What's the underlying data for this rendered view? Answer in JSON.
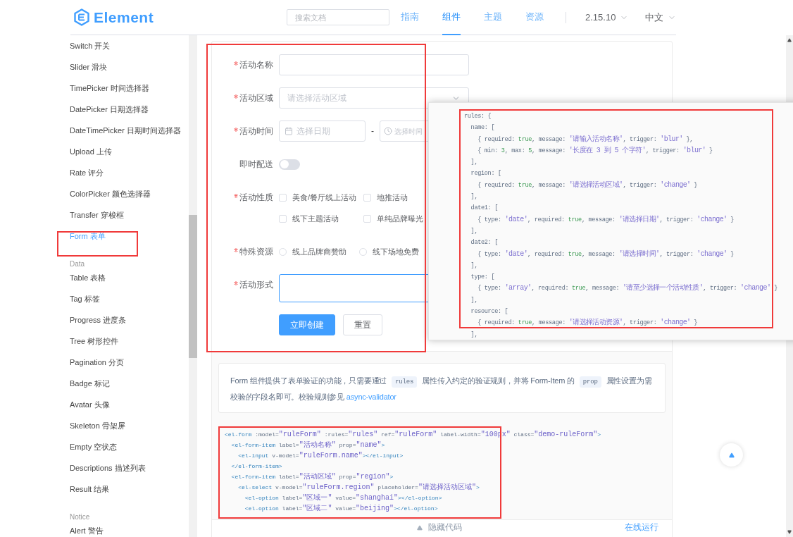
{
  "header": {
    "logo": "Element",
    "search": {
      "placeholder": "搜索文档"
    },
    "nav": [
      {
        "label": "指南",
        "selected": false
      },
      {
        "label": "组件",
        "selected": true
      },
      {
        "label": "主题",
        "selected": false
      },
      {
        "label": "资源",
        "selected": false
      }
    ],
    "version": "2.15.10",
    "language": "中文"
  },
  "sidebar": {
    "items": [
      {
        "kind": "item",
        "label": "Switch 开关",
        "selected": false
      },
      {
        "kind": "item",
        "label": "Slider 滑块",
        "selected": false
      },
      {
        "kind": "item",
        "label": "TimePicker 时间选择器",
        "selected": false
      },
      {
        "kind": "item",
        "label": "DatePicker 日期选择器",
        "selected": false
      },
      {
        "kind": "item",
        "label": "DateTimePicker 日期时间选择器",
        "selected": false
      },
      {
        "kind": "item",
        "label": "Upload 上传",
        "selected": false
      },
      {
        "kind": "item",
        "label": "Rate 评分",
        "selected": false
      },
      {
        "kind": "item",
        "label": "ColorPicker 颜色选择器",
        "selected": false
      },
      {
        "kind": "item",
        "label": "Transfer 穿梭框",
        "selected": false
      },
      {
        "kind": "item",
        "label": "Form 表单",
        "selected": true
      },
      {
        "kind": "group",
        "label": "Data"
      },
      {
        "kind": "item",
        "label": "Table 表格",
        "selected": false
      },
      {
        "kind": "item",
        "label": "Tag 标签",
        "selected": false
      },
      {
        "kind": "item",
        "label": "Progress 进度条",
        "selected": false
      },
      {
        "kind": "item",
        "label": "Tree 树形控件",
        "selected": false
      },
      {
        "kind": "item",
        "label": "Pagination 分页",
        "selected": false
      },
      {
        "kind": "item",
        "label": "Badge 标记",
        "selected": false
      },
      {
        "kind": "item",
        "label": "Avatar 头像",
        "selected": false
      },
      {
        "kind": "item",
        "label": "Skeleton 骨架屏",
        "selected": false
      },
      {
        "kind": "item",
        "label": "Empty 空状态",
        "selected": false
      },
      {
        "kind": "item",
        "label": "Descriptions 描述列表",
        "selected": false
      },
      {
        "kind": "item",
        "label": "Result 结果",
        "selected": false
      },
      {
        "kind": "group",
        "label": "Notice"
      },
      {
        "kind": "item",
        "label": "Alert 警告",
        "selected": false
      }
    ]
  },
  "form": {
    "fields": [
      {
        "kind": "input",
        "label": "活动名称",
        "required": true
      },
      {
        "kind": "select",
        "label": "活动区域",
        "required": true,
        "placeholder": "请选择活动区域"
      },
      {
        "kind": "datetime",
        "label": "活动时间",
        "required": true,
        "date_placeholder": "选择日期",
        "separator": "-",
        "time_placeholder": "选择时间"
      },
      {
        "kind": "switch",
        "label": "即时配送",
        "required": false,
        "on": false
      },
      {
        "kind": "checkboxes",
        "label": "活动性质",
        "required": true,
        "options": [
          {
            "label": "美食/餐厅线上活动",
            "checked": false
          },
          {
            "label": "地推活动",
            "checked": false
          },
          {
            "label": "线下主题活动",
            "checked": false
          },
          {
            "label": "单纯品牌曝光",
            "checked": false
          }
        ]
      },
      {
        "kind": "radios",
        "label": "特殊资源",
        "required": true,
        "options": [
          {
            "label": "线上品牌商赞助",
            "selected": false
          },
          {
            "label": "线下场地免费",
            "selected": false
          }
        ]
      },
      {
        "kind": "textarea",
        "label": "活动形式",
        "required": true,
        "focused": true
      }
    ],
    "buttons": [
      {
        "label": "立即创建",
        "kind": "primary"
      },
      {
        "label": "重置",
        "kind": "default"
      }
    ]
  },
  "description": [
    {
      "kind": "text",
      "text": "Form 组件提供了表单验证的功能，只需要通过"
    },
    {
      "kind": "code",
      "text": "rules"
    },
    {
      "kind": "text",
      "text": "属性传入约定的验证规则，并将 Form-Item 的"
    },
    {
      "kind": "code",
      "text": "prop"
    },
    {
      "kind": "text",
      "text": "属性设置为需校验的字段名即可。校验规则参见 "
    },
    {
      "kind": "link",
      "text": "async-validator"
    }
  ],
  "code": [
    [
      {
        "kind": "tag",
        "text": "<el-form"
      },
      {
        "kind": "attr",
        "text": " :model="
      },
      {
        "kind": "string",
        "text": "\"ruleForm\""
      },
      {
        "kind": "attr",
        "text": " :rules="
      },
      {
        "kind": "string",
        "text": "\"rules\""
      },
      {
        "kind": "attr",
        "text": " ref="
      },
      {
        "kind": "string",
        "text": "\"ruleForm\""
      },
      {
        "kind": "attr",
        "text": " label-width="
      },
      {
        "kind": "string",
        "text": "\"100px\""
      },
      {
        "kind": "attr",
        "text": " class="
      },
      {
        "kind": "string",
        "text": "\"demo-ruleForm\""
      },
      {
        "kind": "tag",
        "text": ">"
      }
    ],
    [
      {
        "kind": "tag",
        "text": "  <el-form-item"
      },
      {
        "kind": "attr",
        "text": " label="
      },
      {
        "kind": "string",
        "text": "\"活动名称\""
      },
      {
        "kind": "attr",
        "text": " prop="
      },
      {
        "kind": "string",
        "text": "\"name\""
      },
      {
        "kind": "tag",
        "text": ">"
      }
    ],
    [
      {
        "kind": "tag",
        "text": "    <el-input"
      },
      {
        "kind": "attr",
        "text": " v-model="
      },
      {
        "kind": "string",
        "text": "\"ruleForm.name\""
      },
      {
        "kind": "tag",
        "text": "></el-input>"
      }
    ],
    [
      {
        "kind": "tag",
        "text": "  </el-form-item>"
      }
    ],
    [
      {
        "kind": "tag",
        "text": "  <el-form-item"
      },
      {
        "kind": "attr",
        "text": " label="
      },
      {
        "kind": "string",
        "text": "\"活动区域\""
      },
      {
        "kind": "attr",
        "text": " prop="
      },
      {
        "kind": "string",
        "text": "\"region\""
      },
      {
        "kind": "tag",
        "text": ">"
      }
    ],
    [
      {
        "kind": "tag",
        "text": "    <el-select"
      },
      {
        "kind": "attr",
        "text": " v-model="
      },
      {
        "kind": "string",
        "text": "\"ruleForm.region\""
      },
      {
        "kind": "attr",
        "text": " placeholder="
      },
      {
        "kind": "string",
        "text": "\"请选择活动区域\""
      },
      {
        "kind": "tag",
        "text": ">"
      }
    ],
    [
      {
        "kind": "tag",
        "text": "      <el-option"
      },
      {
        "kind": "attr",
        "text": " label="
      },
      {
        "kind": "string",
        "text": "\"区域一\""
      },
      {
        "kind": "attr",
        "text": " value="
      },
      {
        "kind": "string",
        "text": "\"shanghai\""
      },
      {
        "kind": "tag",
        "text": "></el-option>"
      }
    ],
    [
      {
        "kind": "tag",
        "text": "      <el-option"
      },
      {
        "kind": "attr",
        "text": " label="
      },
      {
        "kind": "string",
        "text": "\"区域二\""
      },
      {
        "kind": "attr",
        "text": " value="
      },
      {
        "kind": "string",
        "text": "\"beijing\""
      },
      {
        "kind": "tag",
        "text": "></el-option>"
      }
    ]
  ],
  "code_footer": {
    "toggle": "隐藏代码",
    "run": "在线运行"
  },
  "popup": {
    "lines": [
      [
        {
          "kind": "plain",
          "text": "rules: {"
        }
      ],
      [
        {
          "kind": "plain",
          "text": "  name: ["
        }
      ],
      [
        {
          "kind": "plain",
          "text": "    { required: "
        },
        {
          "kind": "literal",
          "text": "true"
        },
        {
          "kind": "plain",
          "text": ", message: "
        },
        {
          "kind": "string",
          "text": "'请输入活动名称'"
        },
        {
          "kind": "plain",
          "text": ", trigger: "
        },
        {
          "kind": "string",
          "text": "'blur'"
        },
        {
          "kind": "plain",
          "text": " },"
        }
      ],
      [
        {
          "kind": "plain",
          "text": "    { min: "
        },
        {
          "kind": "literal",
          "text": "3"
        },
        {
          "kind": "plain",
          "text": ", max: "
        },
        {
          "kind": "literal",
          "text": "5"
        },
        {
          "kind": "plain",
          "text": ", message: "
        },
        {
          "kind": "string",
          "text": "'长度在 3 到 5 个字符'"
        },
        {
          "kind": "plain",
          "text": ", trigger: "
        },
        {
          "kind": "string",
          "text": "'blur'"
        },
        {
          "kind": "plain",
          "text": " }"
        }
      ],
      [
        {
          "kind": "plain",
          "text": "  ],"
        }
      ],
      [
        {
          "kind": "plain",
          "text": "  region: ["
        }
      ],
      [
        {
          "kind": "plain",
          "text": "    { required: "
        },
        {
          "kind": "literal",
          "text": "true"
        },
        {
          "kind": "plain",
          "text": ", message: "
        },
        {
          "kind": "string",
          "text": "'请选择活动区域'"
        },
        {
          "kind": "plain",
          "text": ", trigger: "
        },
        {
          "kind": "string",
          "text": "'change'"
        },
        {
          "kind": "plain",
          "text": " }"
        }
      ],
      [
        {
          "kind": "plain",
          "text": "  ],"
        }
      ],
      [
        {
          "kind": "plain",
          "text": "  date1: ["
        }
      ],
      [
        {
          "kind": "plain",
          "text": "    { type: "
        },
        {
          "kind": "string",
          "text": "'date'"
        },
        {
          "kind": "plain",
          "text": ", required: "
        },
        {
          "kind": "literal",
          "text": "true"
        },
        {
          "kind": "plain",
          "text": ", message: "
        },
        {
          "kind": "string",
          "text": "'请选择日期'"
        },
        {
          "kind": "plain",
          "text": ", trigger: "
        },
        {
          "kind": "string",
          "text": "'change'"
        },
        {
          "kind": "plain",
          "text": " }"
        }
      ],
      [
        {
          "kind": "plain",
          "text": "  ],"
        }
      ],
      [
        {
          "kind": "plain",
          "text": "  date2: ["
        }
      ],
      [
        {
          "kind": "plain",
          "text": "    { type: "
        },
        {
          "kind": "string",
          "text": "'date'"
        },
        {
          "kind": "plain",
          "text": ", required: "
        },
        {
          "kind": "literal",
          "text": "true"
        },
        {
          "kind": "plain",
          "text": ", message: "
        },
        {
          "kind": "string",
          "text": "'请选择时间'"
        },
        {
          "kind": "plain",
          "text": ", trigger: "
        },
        {
          "kind": "string",
          "text": "'change'"
        },
        {
          "kind": "plain",
          "text": " }"
        }
      ],
      [
        {
          "kind": "plain",
          "text": "  ],"
        }
      ],
      [
        {
          "kind": "plain",
          "text": "  type: ["
        }
      ],
      [
        {
          "kind": "plain",
          "text": "    { type: "
        },
        {
          "kind": "string",
          "text": "'array'"
        },
        {
          "kind": "plain",
          "text": ", required: "
        },
        {
          "kind": "literal",
          "text": "true"
        },
        {
          "kind": "plain",
          "text": ", message: "
        },
        {
          "kind": "string",
          "text": "'请至少选择一个活动性质'"
        },
        {
          "kind": "plain",
          "text": ", trigger: "
        },
        {
          "kind": "string",
          "text": "'change'"
        },
        {
          "kind": "plain",
          "text": " }"
        }
      ],
      [
        {
          "kind": "plain",
          "text": "  ],"
        }
      ],
      [
        {
          "kind": "plain",
          "text": "  resource: ["
        }
      ],
      [
        {
          "kind": "plain",
          "text": "    { required: "
        },
        {
          "kind": "literal",
          "text": "true"
        },
        {
          "kind": "plain",
          "text": ", message: "
        },
        {
          "kind": "string",
          "text": "'请选择活动资源'"
        },
        {
          "kind": "plain",
          "text": ", trigger: "
        },
        {
          "kind": "string",
          "text": "'change'"
        },
        {
          "kind": "plain",
          "text": " }"
        }
      ],
      [
        {
          "kind": "plain",
          "text": "  ],"
        }
      ]
    ]
  }
}
